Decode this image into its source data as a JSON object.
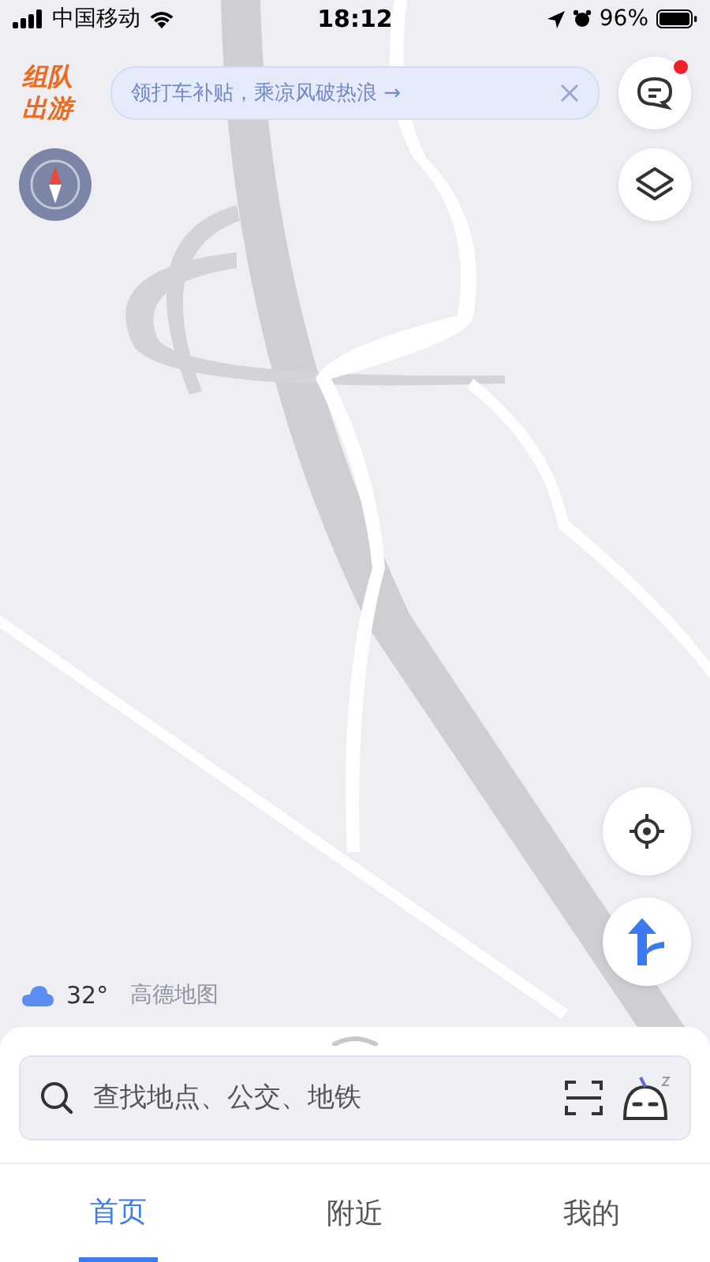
{
  "status_bar": {
    "carrier": "中国移动",
    "time": "18:12",
    "battery": "96%"
  },
  "promo": {
    "lines": [
      "组队",
      "出游"
    ]
  },
  "banner": {
    "text": "领打车补贴，乘凉风破热浪 →"
  },
  "message_button": {
    "unread": true
  },
  "weather": {
    "temperature": "32°"
  },
  "map_brand": "高德地图",
  "search": {
    "placeholder": "查找地点、公交、地铁"
  },
  "tabs": [
    {
      "label": "首页",
      "selected": true
    },
    {
      "label": "附近",
      "selected": false
    },
    {
      "label": "我的",
      "selected": false
    }
  ]
}
